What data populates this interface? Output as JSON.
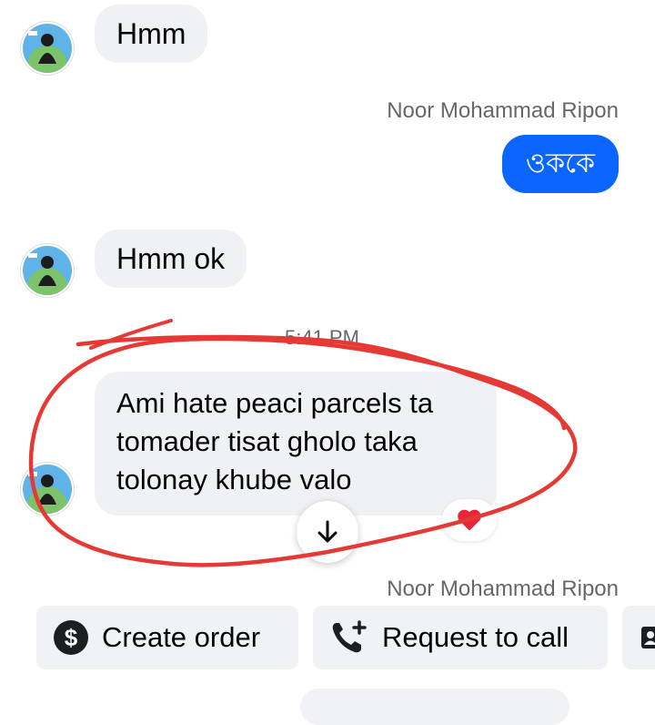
{
  "messages": {
    "msg1": "Hmm",
    "msg2": "ওককে",
    "msg3": "Hmm ok",
    "msg4_line1": "Ami hate peaci parcels ta",
    "msg4_line2": "tomader tisat gholo taka",
    "msg4_line3": "tolonay khube valo"
  },
  "sender_name": "Noor Mohammad Ripon",
  "timestamp": "5:41 PM",
  "actions": {
    "create_order": "Create order",
    "request_call": "Request to call"
  },
  "colors": {
    "outgoing_bubble": "#0a66ff",
    "incoming_bubble": "#f0f1f4",
    "annotation_red": "#e53935"
  },
  "icons": [
    "avatar-image",
    "arrow-down-icon",
    "heart-icon",
    "dollar-circle-icon",
    "phone-plus-icon",
    "contact-card-icon"
  ]
}
